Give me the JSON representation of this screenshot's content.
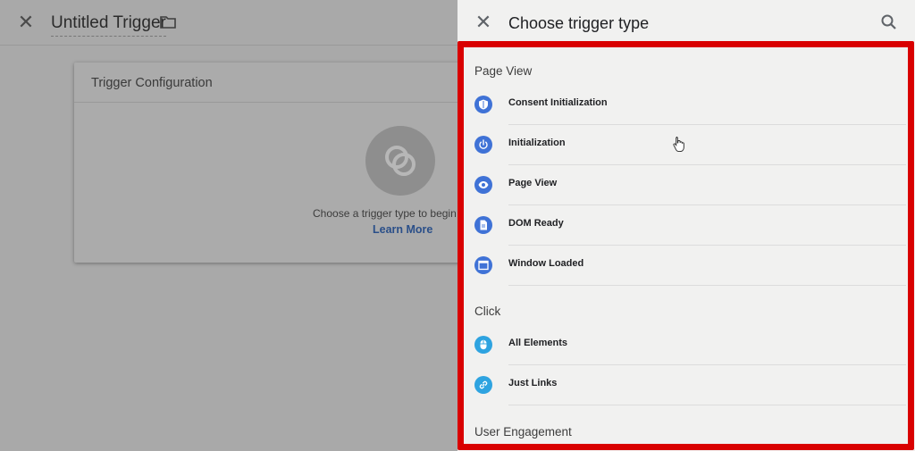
{
  "editor": {
    "close_icon": "close-icon",
    "title": "Untitled Trigger",
    "folder_icon": "folder-icon",
    "card": {
      "title": "Trigger Configuration",
      "placeholder_icon": "trigger-placeholder-icon",
      "prompt": "Choose a trigger type to begin",
      "link": "Learn More"
    }
  },
  "panel": {
    "close_icon": "close-icon",
    "title": "Choose trigger type",
    "search_icon": "search-icon",
    "sections": [
      {
        "heading": "Page View",
        "items": [
          {
            "label": "Consent Initialization",
            "icon": "shield-icon"
          },
          {
            "label": "Initialization",
            "icon": "power-icon"
          },
          {
            "label": "Page View",
            "icon": "eye-icon"
          },
          {
            "label": "DOM Ready",
            "icon": "document-icon"
          },
          {
            "label": "Window Loaded",
            "icon": "window-icon"
          }
        ]
      },
      {
        "heading": "Click",
        "items": [
          {
            "label": "All Elements",
            "icon": "mouse-icon"
          },
          {
            "label": "Just Links",
            "icon": "link-icon"
          }
        ]
      },
      {
        "heading": "User Engagement",
        "items": []
      }
    ]
  },
  "colors": {
    "page_view_icon": "#3f72d6",
    "click_icon": "#2ea3e0",
    "highlight_border": "#d90000",
    "link": "#2a4f89"
  }
}
